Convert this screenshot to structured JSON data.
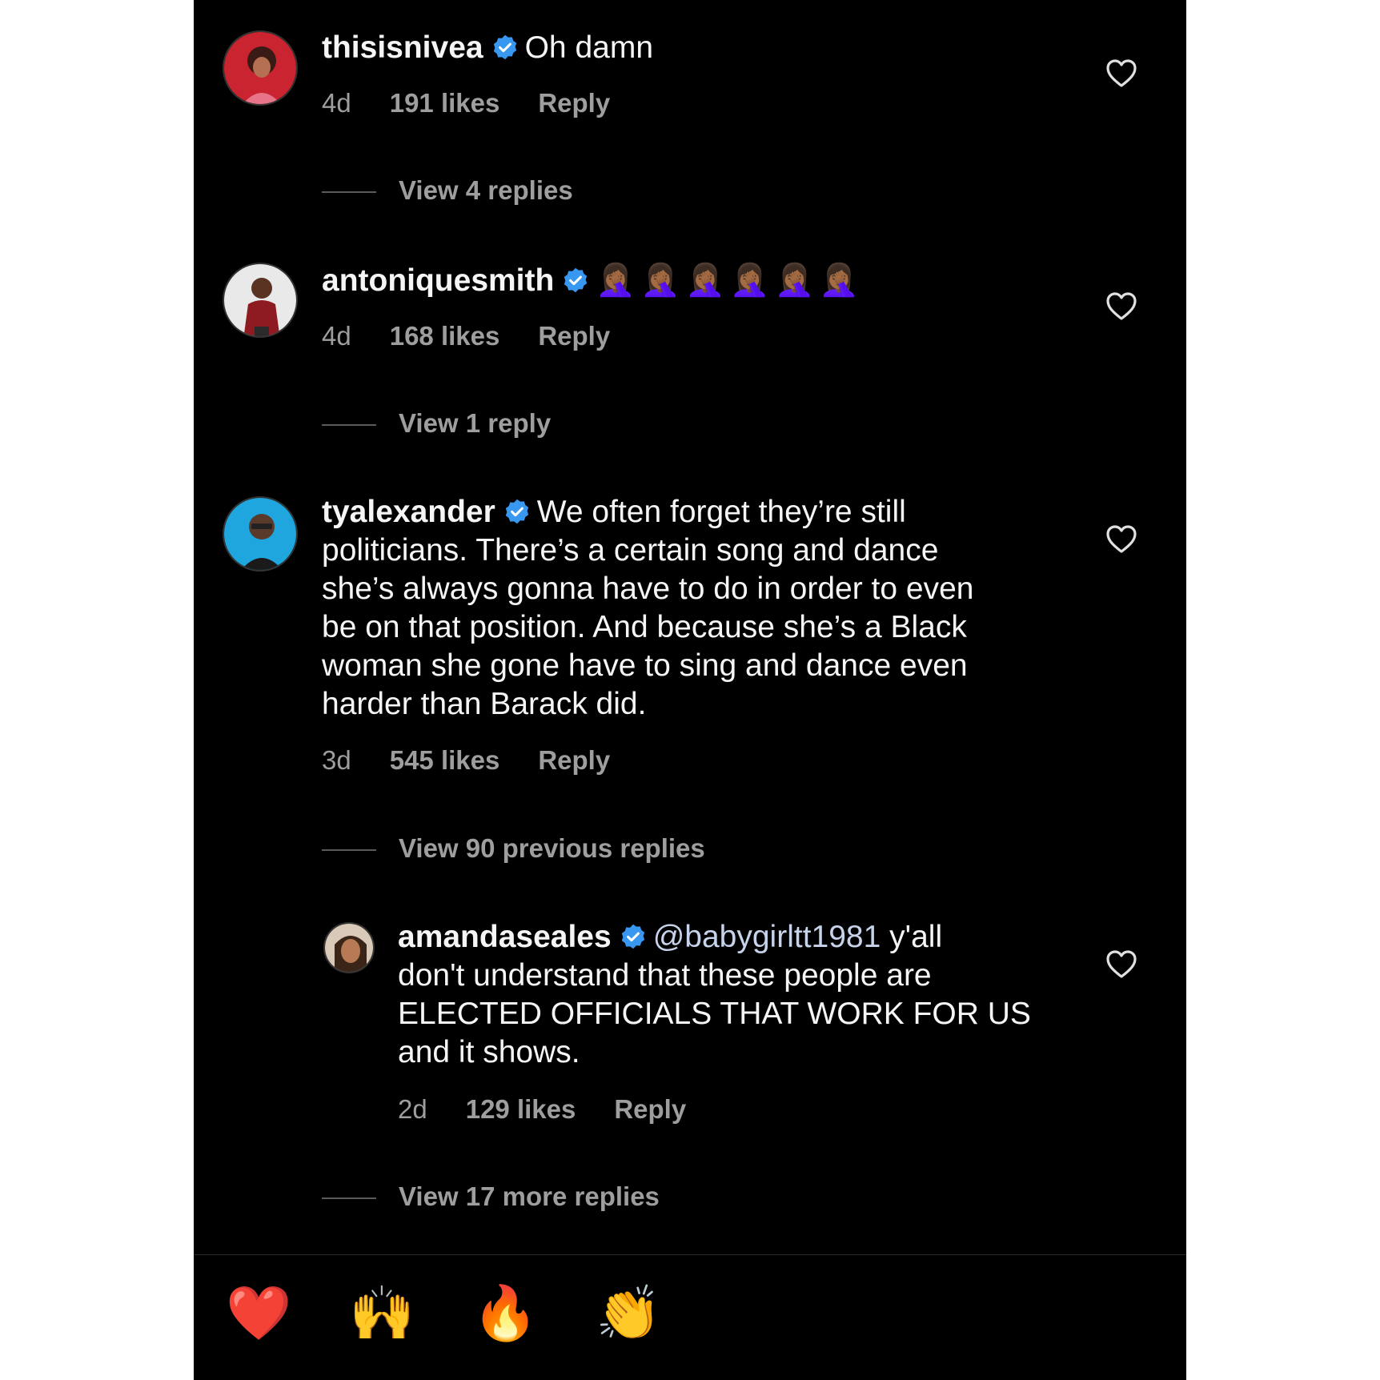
{
  "comments": [
    {
      "username": "thisisnivea",
      "text": "Oh damn",
      "time": "4d",
      "likes": "191 likes",
      "reply": "Reply",
      "view_replies": "View 4 replies"
    },
    {
      "username": "antoniquesmith",
      "text": "🤦🏾‍♀️🤦🏾‍♀️🤦🏾‍♀️🤦🏾‍♀️🤦🏾‍♀️🤦🏾‍♀️",
      "time": "4d",
      "likes": "168 likes",
      "reply": "Reply",
      "view_replies": "View 1 reply"
    },
    {
      "username": "tyalexander",
      "text_lines": [
        "We often forget they’re still",
        "politicians. There’s a certain song and dance",
        "she’s always gonna have to do in order to even",
        "be on that position. And because she’s a Black",
        "woman she gone have to sing and dance even",
        "harder than Barack did."
      ],
      "time": "3d",
      "likes": "545 likes",
      "reply": "Reply",
      "view_replies": "View 90 previous replies"
    }
  ],
  "reply": {
    "username": "amandaseales",
    "mention": "@babygirltt1981",
    "text_lines": [
      "y'all",
      "don't understand that these people are",
      "ELECTED OFFICIALS THAT WORK FOR US",
      "and it shows."
    ],
    "time": "2d",
    "likes": "129 likes",
    "reply": "Reply",
    "view_more": "View 17 more replies"
  },
  "reactions": [
    "❤️",
    "🙌",
    "🔥",
    "👏",
    "😢",
    "😍",
    "😮",
    "😂"
  ],
  "colors": {
    "verified": "#3897f0",
    "background": "#000000",
    "secondary_text": "#9e9e9e"
  },
  "icons": [
    "heart-outline-icon",
    "verified-badge-icon"
  ]
}
